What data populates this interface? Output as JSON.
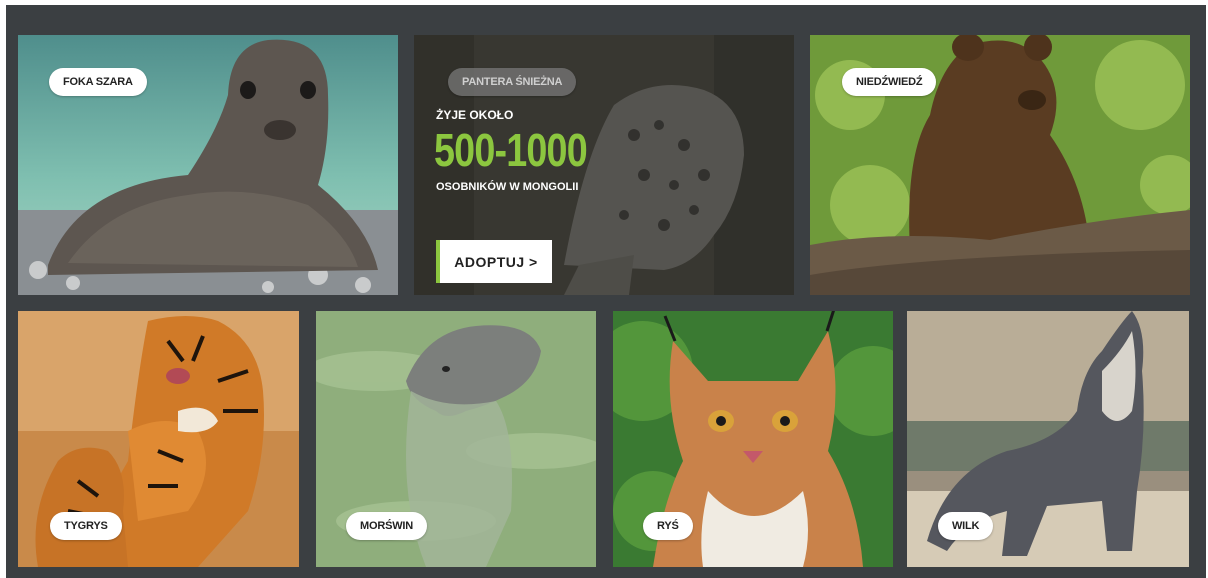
{
  "tiles": {
    "seal": {
      "label": "FOKA SZARA"
    },
    "snow_leopard": {
      "label": "PANTERA ŚNIEŻNA",
      "lives_prefix": "ŻYJE OKOŁO",
      "population": "500-1000",
      "lives_suffix": "OSOBNIKÓW W MONGOLII",
      "adopt_label": "ADOPTUJ >"
    },
    "bear": {
      "label": "NIEDŹWIEDŹ"
    },
    "tiger": {
      "label": "TYGRYS"
    },
    "porpoise": {
      "label": "MORŚWIN"
    },
    "lynx": {
      "label": "RYŚ"
    },
    "wolf": {
      "label": "WILK"
    }
  },
  "colors": {
    "frame": "#3b3f42",
    "accent": "#8cc63f",
    "pill": "#ffffff"
  }
}
